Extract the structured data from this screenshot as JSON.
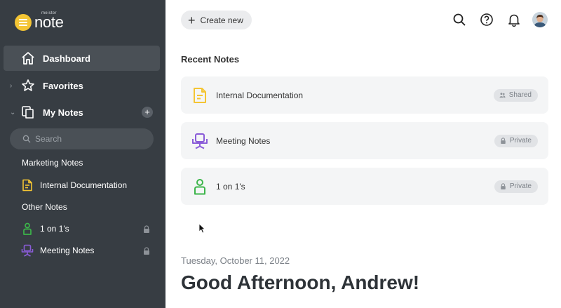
{
  "app": {
    "logo_small": "meister",
    "logo_big": "note"
  },
  "sidebar": {
    "nav": [
      {
        "label": "Dashboard",
        "icon": "home-icon",
        "active": true
      },
      {
        "label": "Favorites",
        "icon": "star-icon"
      },
      {
        "label": "My Notes",
        "icon": "notes-icon"
      }
    ],
    "add_label": "+",
    "search_placeholder": "Search",
    "groups": [
      {
        "title": "Marketing Notes",
        "notes": [
          {
            "label": "Internal Documentation",
            "icon": "document-icon"
          }
        ]
      },
      {
        "title": "Other Notes",
        "notes": [
          {
            "label": "1 on 1's",
            "icon": "person-icon",
            "locked": true
          },
          {
            "label": "Meeting Notes",
            "icon": "chair-icon",
            "locked": true
          }
        ]
      }
    ]
  },
  "header": {
    "create_label": "Create new",
    "icons": [
      "search-icon",
      "help-icon",
      "bell-icon",
      "avatar"
    ]
  },
  "main": {
    "recent_title": "Recent Notes",
    "recent": [
      {
        "label": "Internal Documentation",
        "badge": "Shared",
        "icon": "document-icon",
        "color": "#f4c534"
      },
      {
        "label": "Meeting Notes",
        "badge": "Private",
        "icon": "chair-icon",
        "color": "#8a5cd8"
      },
      {
        "label": "1 on 1's",
        "badge": "Private",
        "icon": "person-icon",
        "color": "#3cb54a"
      }
    ],
    "date": "Tuesday, October 11, 2022",
    "greeting": "Good Afternoon, Andrew!"
  },
  "colors": {
    "sidebar_bg": "#373d43",
    "accent_yellow": "#f4c534",
    "accent_purple": "#8a5cd8",
    "accent_green": "#3cb54a"
  }
}
